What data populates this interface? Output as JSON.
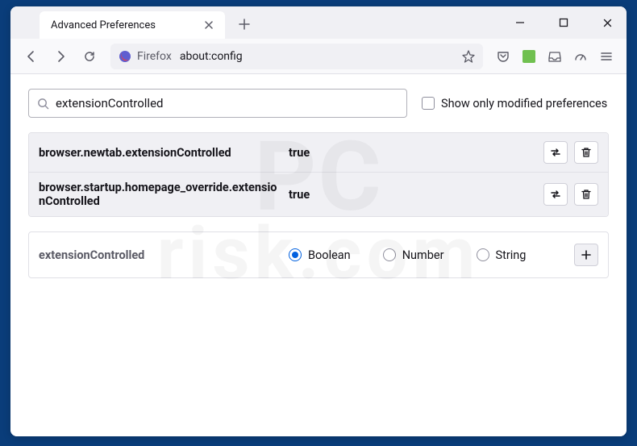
{
  "window": {
    "tab_title": "Advanced Preferences"
  },
  "nav": {
    "brand": "Firefox",
    "address": "about:config"
  },
  "search": {
    "value": "extensionControlled",
    "checkbox_label": "Show only modified preferences"
  },
  "prefs": [
    {
      "name": "browser.newtab.extensionControlled",
      "value": "true"
    },
    {
      "name": "browser.startup.homepage_override.extensionControlled",
      "value": "true"
    }
  ],
  "add": {
    "name": "extensionControlled",
    "options": [
      "Boolean",
      "Number",
      "String"
    ],
    "selected": 0
  },
  "watermark": {
    "line1": "PC",
    "line2": "risk.com"
  }
}
